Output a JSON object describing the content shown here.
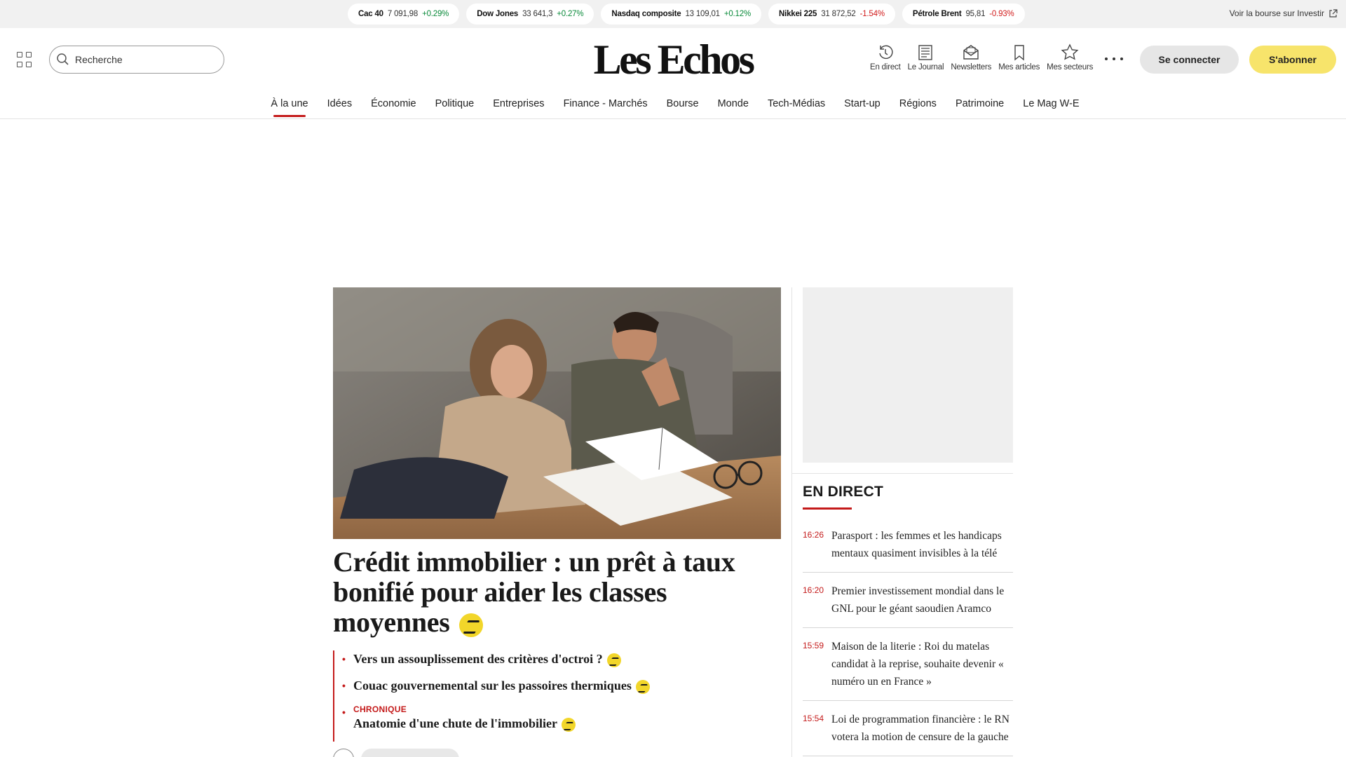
{
  "ticker": {
    "quotes": [
      {
        "name": "Cac 40",
        "value": "7 091,98",
        "change": "+0.29%",
        "direction": "up"
      },
      {
        "name": "Dow Jones",
        "value": "33 641,3",
        "change": "+0.27%",
        "direction": "up"
      },
      {
        "name": "Nasdaq composite",
        "value": "13 109,01",
        "change": "+0.12%",
        "direction": "up"
      },
      {
        "name": "Nikkei 225",
        "value": "31 872,52",
        "change": "-1.54%",
        "direction": "down"
      },
      {
        "name": "Pétrole Brent",
        "value": "95,81",
        "change": "-0.93%",
        "direction": "down"
      }
    ],
    "investir_link": "Voir la bourse sur Investir"
  },
  "header": {
    "search_placeholder": "Recherche",
    "logo": "Les Echos",
    "tools": [
      {
        "label": "En direct",
        "icon": "clock-refresh-icon"
      },
      {
        "label": "Le Journal",
        "icon": "newspaper-icon"
      },
      {
        "label": "Newsletters",
        "icon": "envelope-icon"
      },
      {
        "label": "Mes articles",
        "icon": "bookmark-icon"
      },
      {
        "label": "Mes secteurs",
        "icon": "star-icon"
      }
    ],
    "login": "Se connecter",
    "subscribe": "S'abonner"
  },
  "nav": {
    "items": [
      "À la une",
      "Idées",
      "Économie",
      "Politique",
      "Entreprises",
      "Finance - Marchés",
      "Bourse",
      "Monde",
      "Tech-Médias",
      "Start-up",
      "Régions",
      "Patrimoine",
      "Le Mag W-E"
    ],
    "active": "À la une"
  },
  "main": {
    "headline": "Crédit immobilier : un prêt à taux bonifié pour aider les classes moyennes",
    "related": [
      {
        "kicker": "",
        "title": "Vers un assouplissement des critères d'octroi ?"
      },
      {
        "kicker": "",
        "title": "Couac gouvernemental sur les passoires thermiques"
      },
      {
        "kicker": "CHRONIQUE",
        "title": "Anatomie d'une chute de l'immobilier"
      }
    ]
  },
  "live": {
    "title": "EN DIRECT",
    "items": [
      {
        "time": "16:26",
        "text": "Parasport : les femmes et les handicaps mentaux quasiment invisibles à la télé"
      },
      {
        "time": "16:20",
        "text": "Premier investissement mondial dans le GNL pour le géant saoudien Aramco"
      },
      {
        "time": "15:59",
        "text": "Maison de la literie : Roi du matelas candidat à la reprise, souhaite devenir « numéro un en France »"
      },
      {
        "time": "15:54",
        "text": "Loi de programmation financière : le RN votera la motion de censure de la gauche"
      }
    ]
  },
  "colors": {
    "accent_red": "#c41a1a",
    "subscribe_yellow": "#f7e46b",
    "up_green": "#0a8a3a",
    "down_red": "#d11b1b"
  }
}
